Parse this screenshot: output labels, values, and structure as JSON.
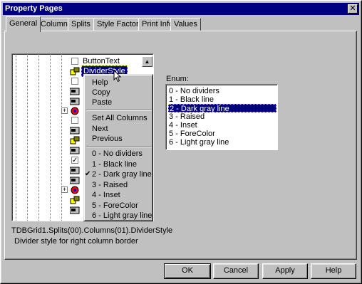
{
  "window": {
    "title": "Property Pages",
    "close_glyph": "✕"
  },
  "tabs": [
    {
      "label": "General",
      "active": true
    },
    {
      "label": "Columns"
    },
    {
      "label": "Splits"
    },
    {
      "label": "Style Factory"
    },
    {
      "label": "Print Info"
    },
    {
      "label": "Values"
    }
  ],
  "tree": {
    "items": [
      {
        "label": "ButtonText",
        "icon": "checkbox-icon"
      },
      {
        "label": "DividerStyle",
        "icon": "property-icon",
        "selected": true
      }
    ],
    "scroll_glyph": "▲"
  },
  "context_menu": {
    "items": [
      {
        "label": "Help"
      },
      {
        "label": "Copy"
      },
      {
        "label": "Paste"
      },
      {
        "label": "Set All Columns"
      },
      {
        "label": "Next"
      },
      {
        "label": "Previous"
      },
      {
        "label": "0 - No dividers"
      },
      {
        "label": "1 - Black line"
      },
      {
        "label": "2 - Dark gray line",
        "checked": true
      },
      {
        "label": "3 - Raised"
      },
      {
        "label": "4 - Inset"
      },
      {
        "label": "5 - ForeColor"
      },
      {
        "label": "6 - Light gray line"
      }
    ],
    "check_glyph": "✔"
  },
  "enum": {
    "label": "Enum:",
    "options": [
      "0 - No dividers",
      "1 - Black line",
      "2 - Dark gray line",
      "3 - Raised",
      "4 - Inset",
      "5 - ForeColor",
      "6 - Light gray line"
    ],
    "selected_index": 2
  },
  "status": {
    "path": "TDBGrid1.Splits(00).Columns(01).DividerStyle",
    "description": "Divider style for right column border"
  },
  "buttons": {
    "ok": "OK",
    "cancel": "Cancel",
    "apply": "Apply",
    "help": "Help"
  },
  "colors": {
    "title_bar": "#000080",
    "face": "#c0c0c0",
    "selection": "#000080"
  }
}
